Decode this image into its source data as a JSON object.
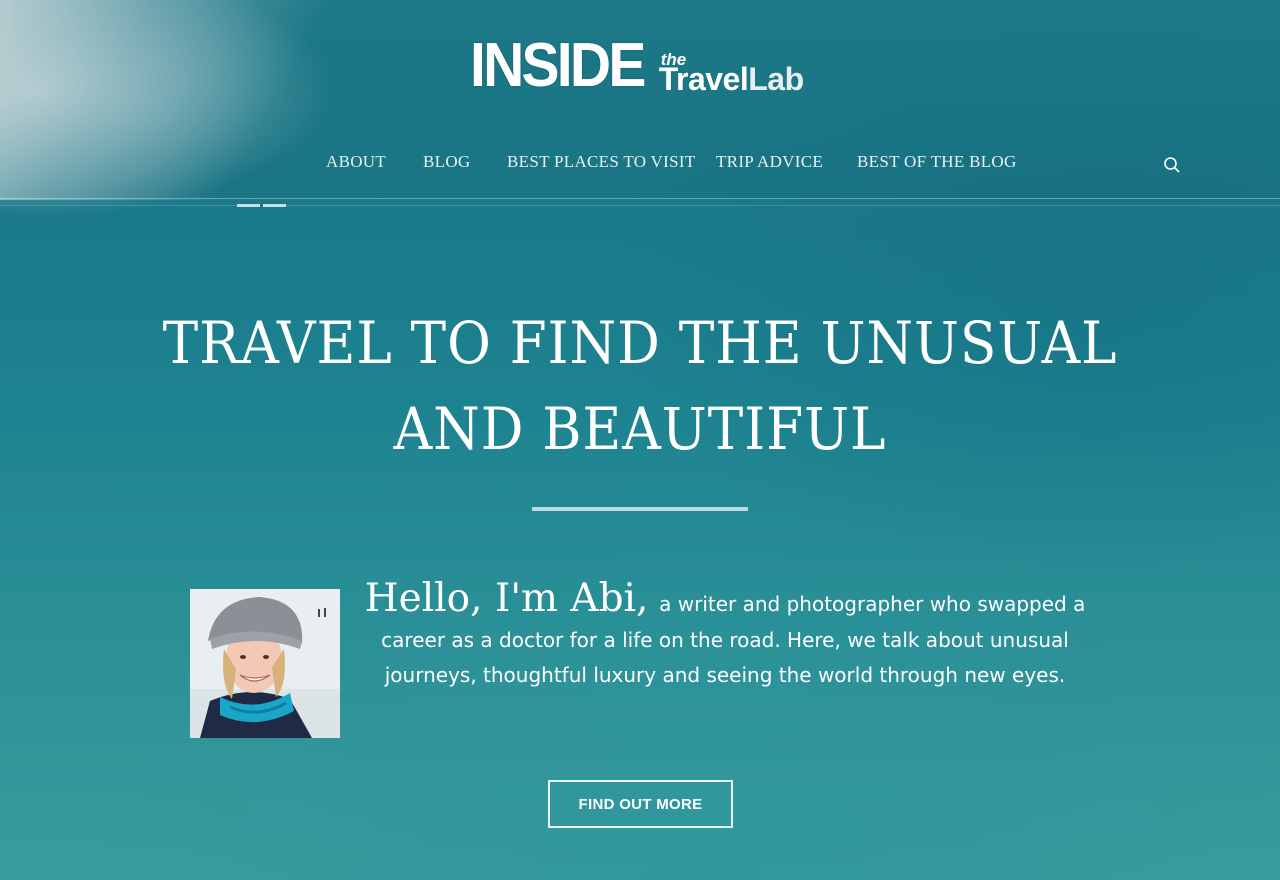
{
  "logo": {
    "main": "INSIDE",
    "the": "the",
    "travel": "Travel",
    "lab": "Lab"
  },
  "nav": {
    "items": [
      {
        "label": "ABOUT"
      },
      {
        "label": "BLOG"
      },
      {
        "label": "BEST PLACES TO VISIT"
      },
      {
        "label": "TRIP ADVICE"
      },
      {
        "label": "BEST OF THE BLOG"
      }
    ],
    "search_icon": "search-icon"
  },
  "hero": {
    "title": "TRAVEL TO FIND THE UNUSUAL AND BEAUTIFUL"
  },
  "intro": {
    "greeting": "Hello, I'm Abi,",
    "text": "a writer and photographer who swapped a career as a doctor for a life on the road. Here, we talk about unusual journeys, thoughtful luxury and seeing the world through new eyes."
  },
  "cta": {
    "label": "FIND OUT MORE"
  },
  "colors": {
    "sea": "#1e7f8f",
    "text": "#ffffff"
  }
}
